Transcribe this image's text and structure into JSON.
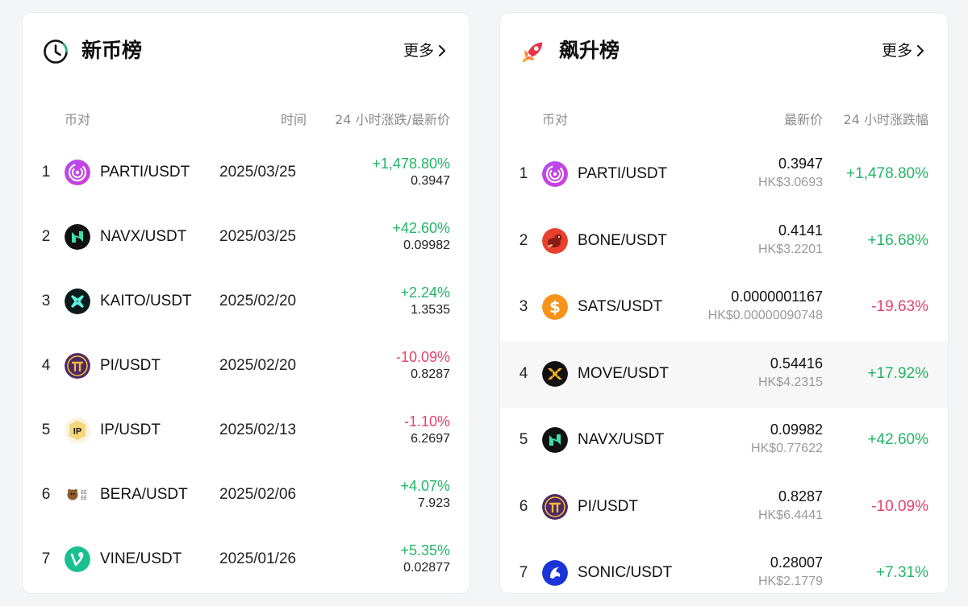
{
  "new_listings": {
    "title": "新币榜",
    "more_label": "更多",
    "icon": "clock-icon",
    "columns": {
      "pair": "币对",
      "time": "时间",
      "change_price": "24 小时涨跌/最新价"
    },
    "rows": [
      {
        "rank": "1",
        "pair": "PARTI/USDT",
        "date": "2025/03/25",
        "change": "+1,478.80%",
        "price": "0.3947",
        "direction": "up",
        "icon": "parti-coin-icon"
      },
      {
        "rank": "2",
        "pair": "NAVX/USDT",
        "date": "2025/03/25",
        "change": "+42.60%",
        "price": "0.09982",
        "direction": "up",
        "icon": "navx-coin-icon"
      },
      {
        "rank": "3",
        "pair": "KAITO/USDT",
        "date": "2025/02/20",
        "change": "+2.24%",
        "price": "1.3535",
        "direction": "up",
        "icon": "kaito-coin-icon"
      },
      {
        "rank": "4",
        "pair": "PI/USDT",
        "date": "2025/02/20",
        "change": "-10.09%",
        "price": "0.8287",
        "direction": "down",
        "icon": "pi-coin-icon"
      },
      {
        "rank": "5",
        "pair": "IP/USDT",
        "date": "2025/02/13",
        "change": "-1.10%",
        "price": "6.2697",
        "direction": "down",
        "icon": "ip-coin-icon"
      },
      {
        "rank": "6",
        "pair": "BERA/USDT",
        "date": "2025/02/06",
        "change": "+4.07%",
        "price": "7.923",
        "direction": "up",
        "icon": "bera-coin-icon"
      },
      {
        "rank": "7",
        "pair": "VINE/USDT",
        "date": "2025/01/26",
        "change": "+5.35%",
        "price": "0.02877",
        "direction": "up",
        "icon": "vine-coin-icon"
      }
    ]
  },
  "top_gainers": {
    "title": "飙升榜",
    "more_label": "更多",
    "icon": "rocket-icon",
    "columns": {
      "pair": "币对",
      "price": "最新价",
      "change": "24 小时涨跌幅"
    },
    "rows": [
      {
        "rank": "1",
        "pair": "PARTI/USDT",
        "price": "0.3947",
        "price_hkd": "HK$3.0693",
        "change": "+1,478.80%",
        "direction": "up",
        "icon": "parti-coin-icon"
      },
      {
        "rank": "2",
        "pair": "BONE/USDT",
        "price": "0.4141",
        "price_hkd": "HK$3.2201",
        "change": "+16.68%",
        "direction": "up",
        "icon": "bone-coin-icon"
      },
      {
        "rank": "3",
        "pair": "SATS/USDT",
        "price": "0.0000001167",
        "price_hkd": "HK$0.00000090748",
        "change": "-19.63%",
        "direction": "down",
        "icon": "sats-coin-icon"
      },
      {
        "rank": "4",
        "pair": "MOVE/USDT",
        "price": "0.54416",
        "price_hkd": "HK$4.2315",
        "change": "+17.92%",
        "direction": "up",
        "icon": "move-coin-icon",
        "highlighted": true
      },
      {
        "rank": "5",
        "pair": "NAVX/USDT",
        "price": "0.09982",
        "price_hkd": "HK$0.77622",
        "change": "+42.60%",
        "direction": "up",
        "icon": "navx-coin-icon"
      },
      {
        "rank": "6",
        "pair": "PI/USDT",
        "price": "0.8287",
        "price_hkd": "HK$6.4441",
        "change": "-10.09%",
        "direction": "down",
        "icon": "pi-coin-icon"
      },
      {
        "rank": "7",
        "pair": "SONIC/USDT",
        "price": "0.28007",
        "price_hkd": "HK$2.1779",
        "change": "+7.31%",
        "direction": "up",
        "icon": "sonic-coin-icon"
      }
    ]
  },
  "colors": {
    "up": "#22b567",
    "down": "#e8416a",
    "muted": "#8b8b8b"
  }
}
